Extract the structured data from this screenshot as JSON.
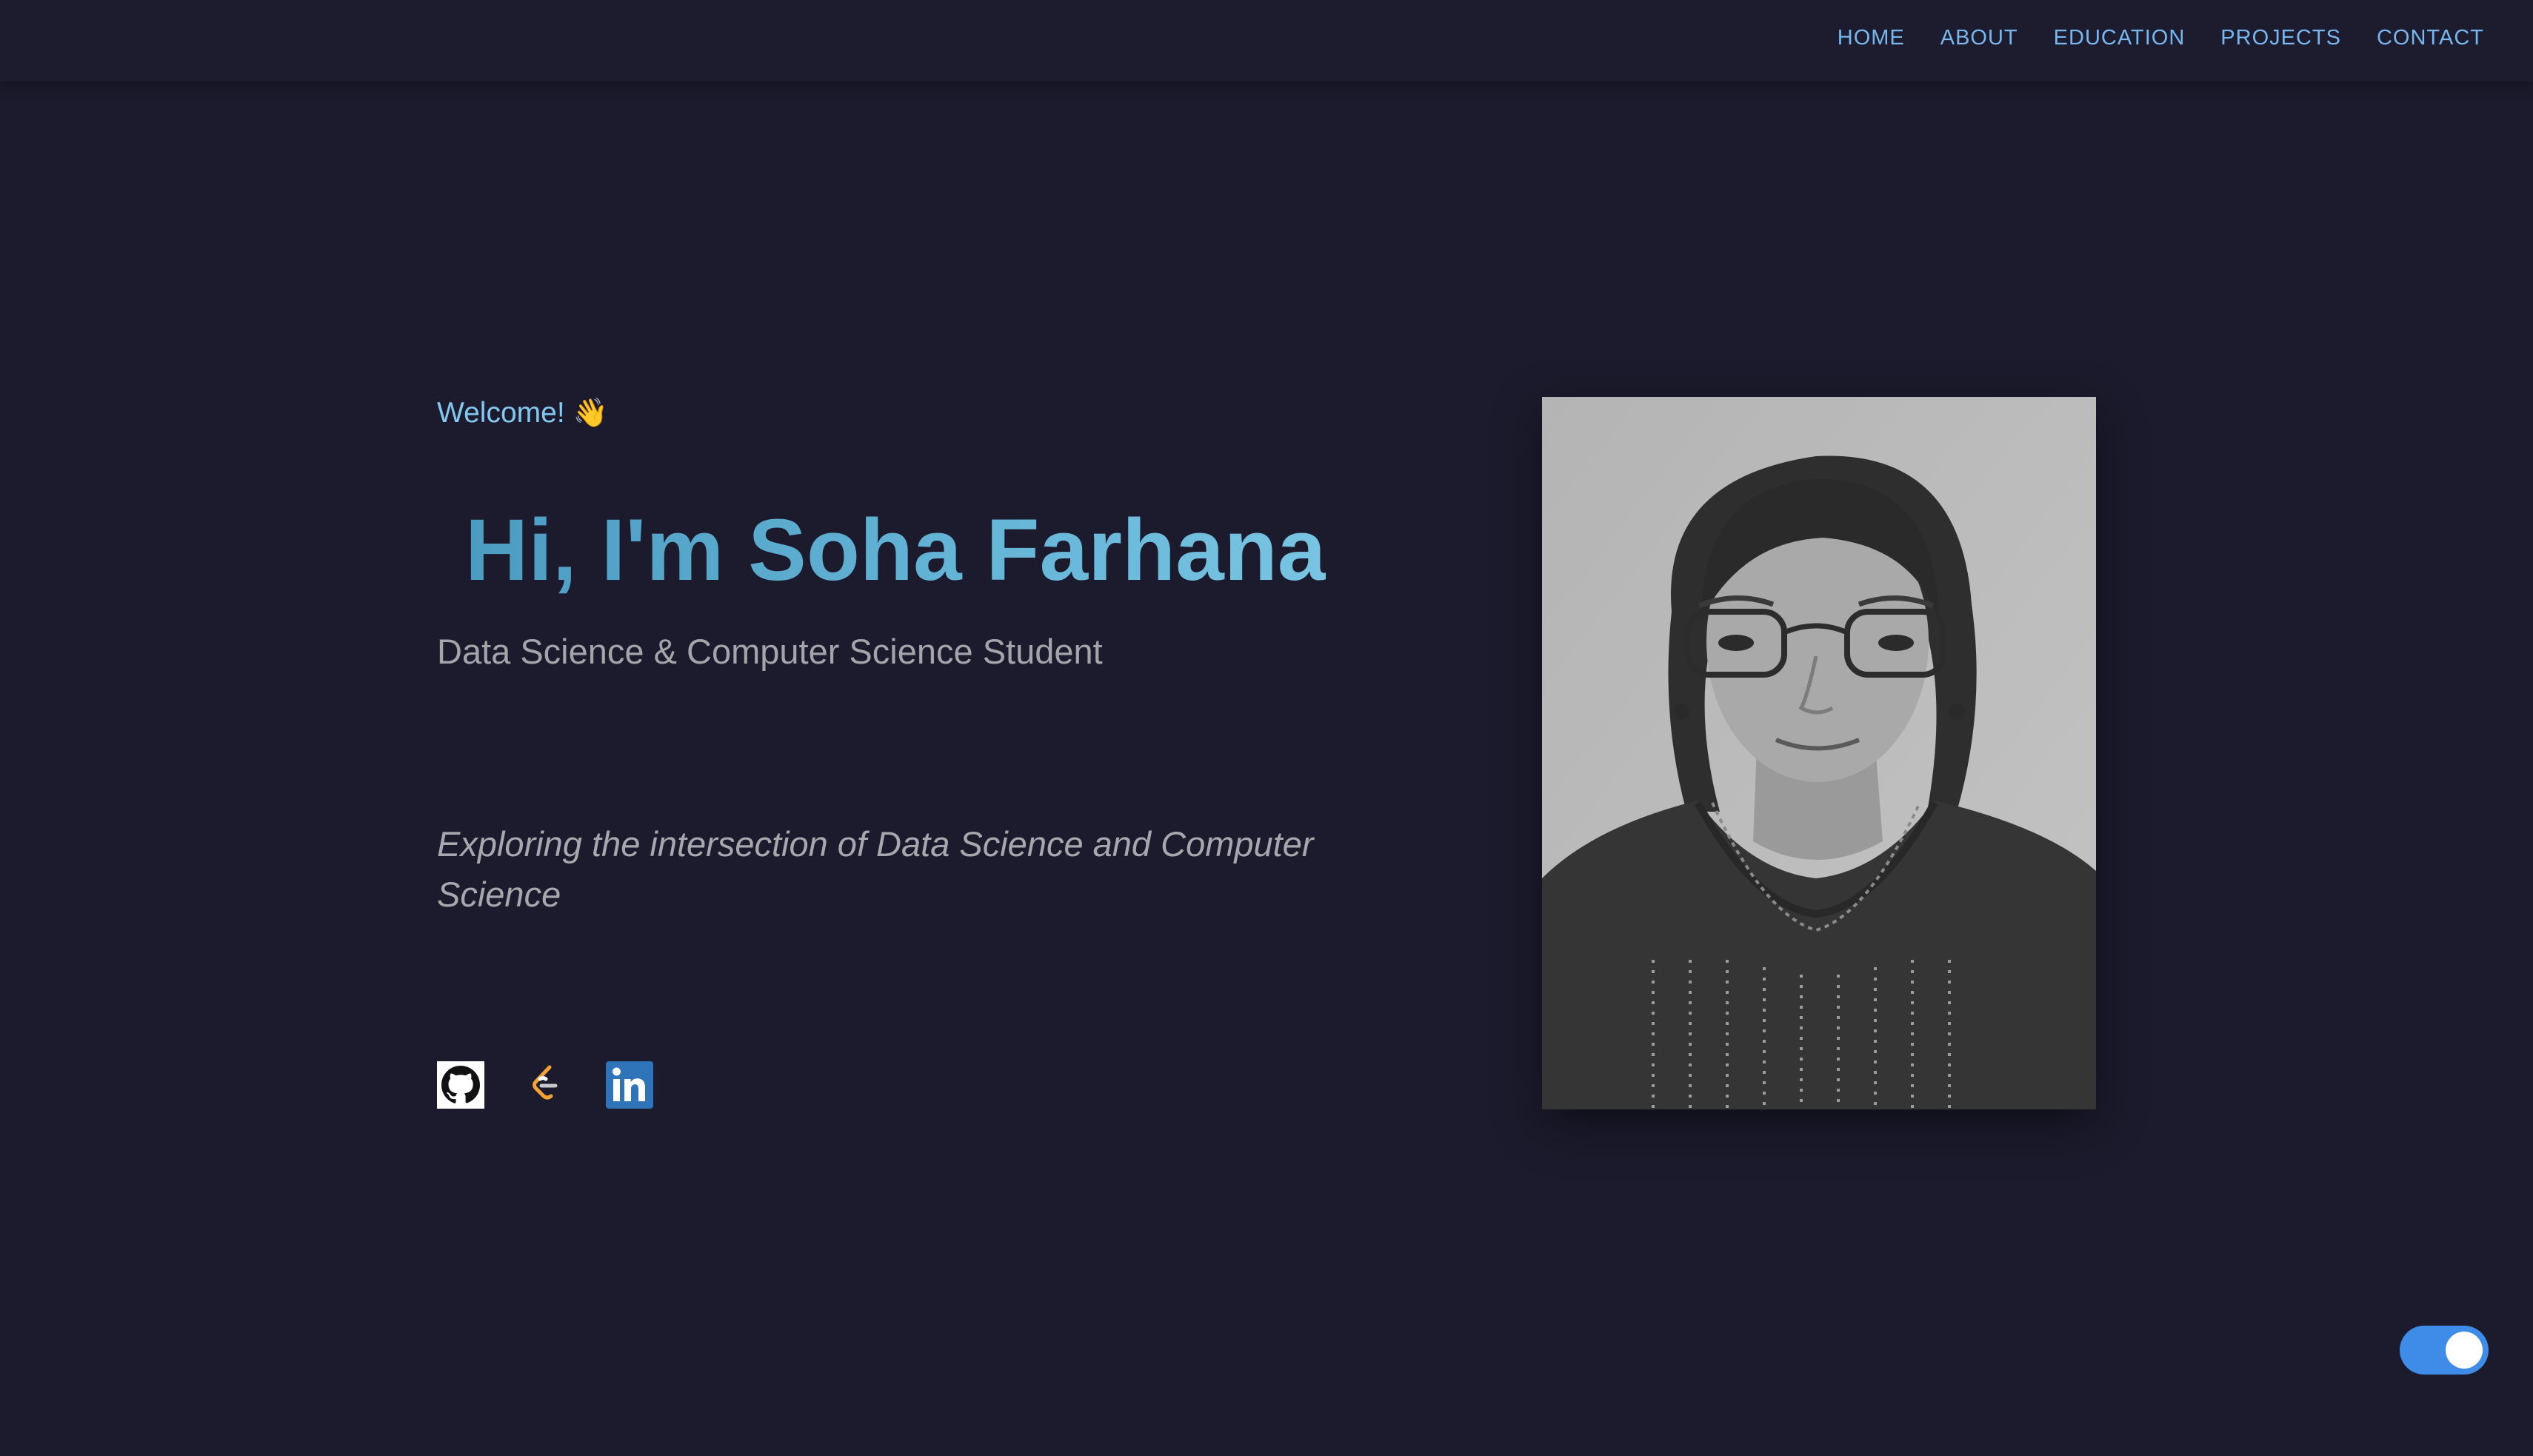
{
  "nav": {
    "items": [
      {
        "label": "HOME"
      },
      {
        "label": "ABOUT"
      },
      {
        "label": "EDUCATION"
      },
      {
        "label": "PROJECTS"
      },
      {
        "label": "CONTACT"
      }
    ]
  },
  "hero": {
    "welcome": "Welcome!",
    "wave": "👋",
    "title": "Hi, I'm Soha Farhana",
    "subtitle": "Data Science & Computer Science Student",
    "tagline": "Exploring the intersection of Data Science and Computer Science"
  },
  "socials": [
    {
      "icon": "github-icon"
    },
    {
      "icon": "leetcode-icon"
    },
    {
      "icon": "linkedin-icon"
    }
  ],
  "portrait": {
    "icon": "profile-photo"
  },
  "theme_toggle": {
    "on": true
  },
  "colors": {
    "background": "#1b1b2d",
    "nav_link": "#78b6f0",
    "welcome": "#84c8f0",
    "title_gradient_start": "#4c9cc2",
    "title_gradient_end": "#78c4e2",
    "body_text": "#a4a4ab",
    "toggle": "#3e8ce8"
  }
}
